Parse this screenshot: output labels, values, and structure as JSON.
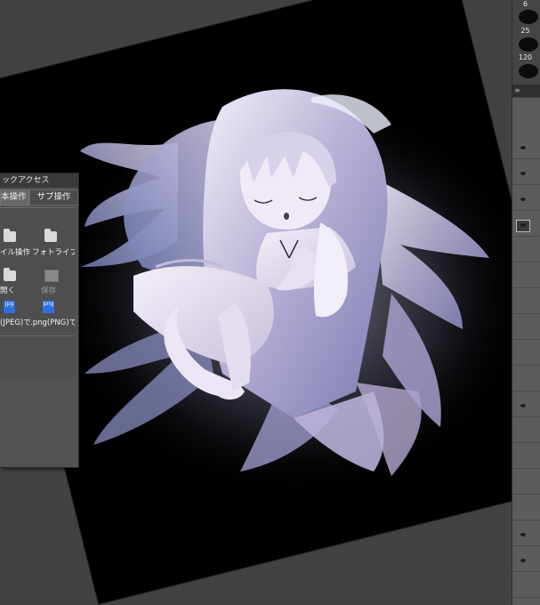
{
  "quick_access": {
    "title": "ックアクセス",
    "tabs": [
      "本操作",
      "サブ操作"
    ],
    "items": [
      {
        "label": "イル操作",
        "icon": "folder-icon"
      },
      {
        "label": "フォトライブ",
        "icon": "folder-icon"
      },
      {
        "label": "開く",
        "icon": "open-folder-icon"
      },
      {
        "label": "保存",
        "icon": "save-icon",
        "disabled": true
      },
      {
        "label": "(JPEG)で",
        "icon": "jpg-file-icon",
        "badge": "jpg"
      },
      {
        "label": ".png(PNG)で",
        "icon": "png-file-icon",
        "badge": "png"
      }
    ]
  },
  "brush_sizes": [
    "6",
    "25",
    "120"
  ],
  "colors": {
    "workspace": "#424242",
    "canvas": "#000000",
    "panel": "#525252",
    "file_icon": "#2d6fe0"
  }
}
